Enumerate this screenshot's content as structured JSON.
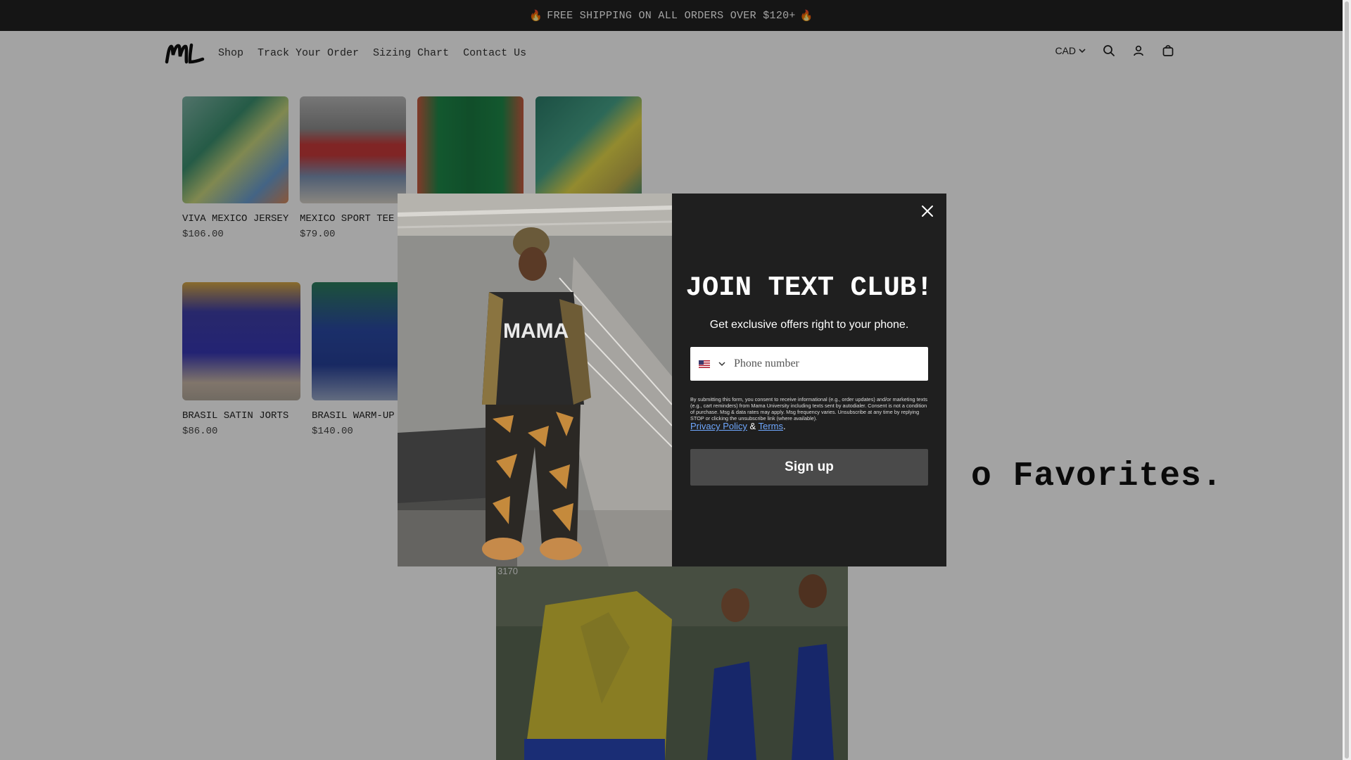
{
  "announcement": {
    "flame_left": "🔥",
    "text": "FREE SHIPPING ON ALL ORDERS OVER $120+",
    "flame_right": "🔥"
  },
  "header": {
    "logo_text": "ML",
    "nav": [
      "Shop",
      "Track Your Order",
      "Sizing Chart",
      "Contact Us"
    ],
    "currency": "CAD",
    "icons": [
      "search-icon",
      "account-icon",
      "cart-icon"
    ]
  },
  "products_row1": [
    {
      "name": "VIVA MEXICO JERSEY",
      "price": "$106.00"
    },
    {
      "name": "MEXICO SPORT TEE",
      "price": "$79.00"
    },
    {
      "name": "",
      "price": ""
    },
    {
      "name": "",
      "price": ""
    }
  ],
  "products_row2": [
    {
      "name": "BRASIL SATIN JORTS",
      "price": "$86.00"
    },
    {
      "name": "BRASIL WARM-UP",
      "price": "$140.00"
    }
  ],
  "section_title": "o Favorites.",
  "hero_badge": "3170",
  "modal": {
    "title": "JOIN TEXT CLUB!",
    "subtitle": "Get exclusive offers right to your phone.",
    "phone_placeholder": "Phone number",
    "consent": "By submitting this form, you consent to receive informational (e.g., order updates) and/or marketing texts (e.g., cart reminders) from Mama University including texts sent by autodialer. Consent is not a condition of purchase. Msg & data rates may apply. Msg frequency varies. Unsubscribe at any time by replying STOP or clicking the unsubscribe link (where available).",
    "privacy_label": "Privacy Policy",
    "amp": "&",
    "terms_label": "Terms",
    "period": ".",
    "signup_label": "Sign up",
    "shirt_text": "MAMA"
  },
  "colors": {
    "announcement_bg": "#222222",
    "modal_panel": "#1f1f1f",
    "button": "#4a4a4a",
    "link": "#6fa8ff"
  }
}
